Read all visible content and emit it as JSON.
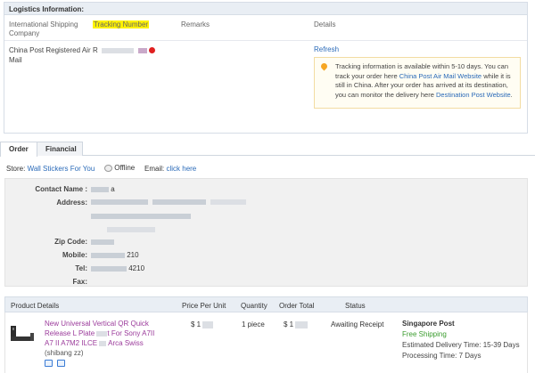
{
  "logistics": {
    "heading": "Logistics Information:",
    "columns": {
      "company": "International Shipping Company",
      "tracking": "Tracking Number",
      "remarks": "Remarks",
      "details": "Details"
    },
    "company_name": "China Post Registered Air Mail",
    "tracking_number_visible": "R",
    "refresh_label": "Refresh",
    "notice": {
      "part1": "Tracking information is available within 5-10 days. You can track your order here ",
      "link1": "China Post Air Mail Website",
      "part2": " while it is still in China. After your order has arrived at its destination, you can monitor the delivery here ",
      "link2": "Destination Post Website",
      "part3": "."
    }
  },
  "tabs": [
    {
      "label": "Order",
      "active": true
    },
    {
      "label": "Financial",
      "active": false
    }
  ],
  "store": {
    "store_label": "Store:",
    "store_name": "Wall Stickers For You",
    "status": "Offline",
    "email_label": "Email:",
    "email_link": "click here"
  },
  "contact": {
    "name_label": "Contact Name :",
    "name_value": "a",
    "address_label": "Address:",
    "zip_label": "Zip Code:",
    "mobile_label": "Mobile:",
    "mobile_value": "210",
    "tel_label": "Tel:",
    "tel_value": "4210",
    "fax_label": "Fax:"
  },
  "product_table": {
    "headers": {
      "details": "Product Details",
      "price": "Price Per Unit",
      "quantity": "Quantity",
      "total": "Order Total",
      "status": "Status"
    },
    "row": {
      "title_line1": "New Universal Vertical QR Quick",
      "title_line2_a": "Release L Plate",
      "title_line2_b": "t For Sony A7II",
      "title_line3_a": "A7 II A7M2 ILCE",
      "title_line3_b": "Arca Swiss",
      "sku": "(shibang zz)",
      "price": "$ 1",
      "quantity": "1 piece",
      "total": "$ 1",
      "status": "Awaiting Receipt",
      "shipping_method": "Singapore Post",
      "shipping_cost": "Free Shipping",
      "delivery_time": "Estimated Delivery Time: 15-39 Days",
      "processing_time": "Processing Time: 7 Days"
    }
  },
  "colors": {
    "link": "#2a6ab8",
    "product_link": "#9b3b9b",
    "highlight": "#fff200",
    "free_shipping": "#3a9c2e",
    "pin": "#f6a623"
  }
}
